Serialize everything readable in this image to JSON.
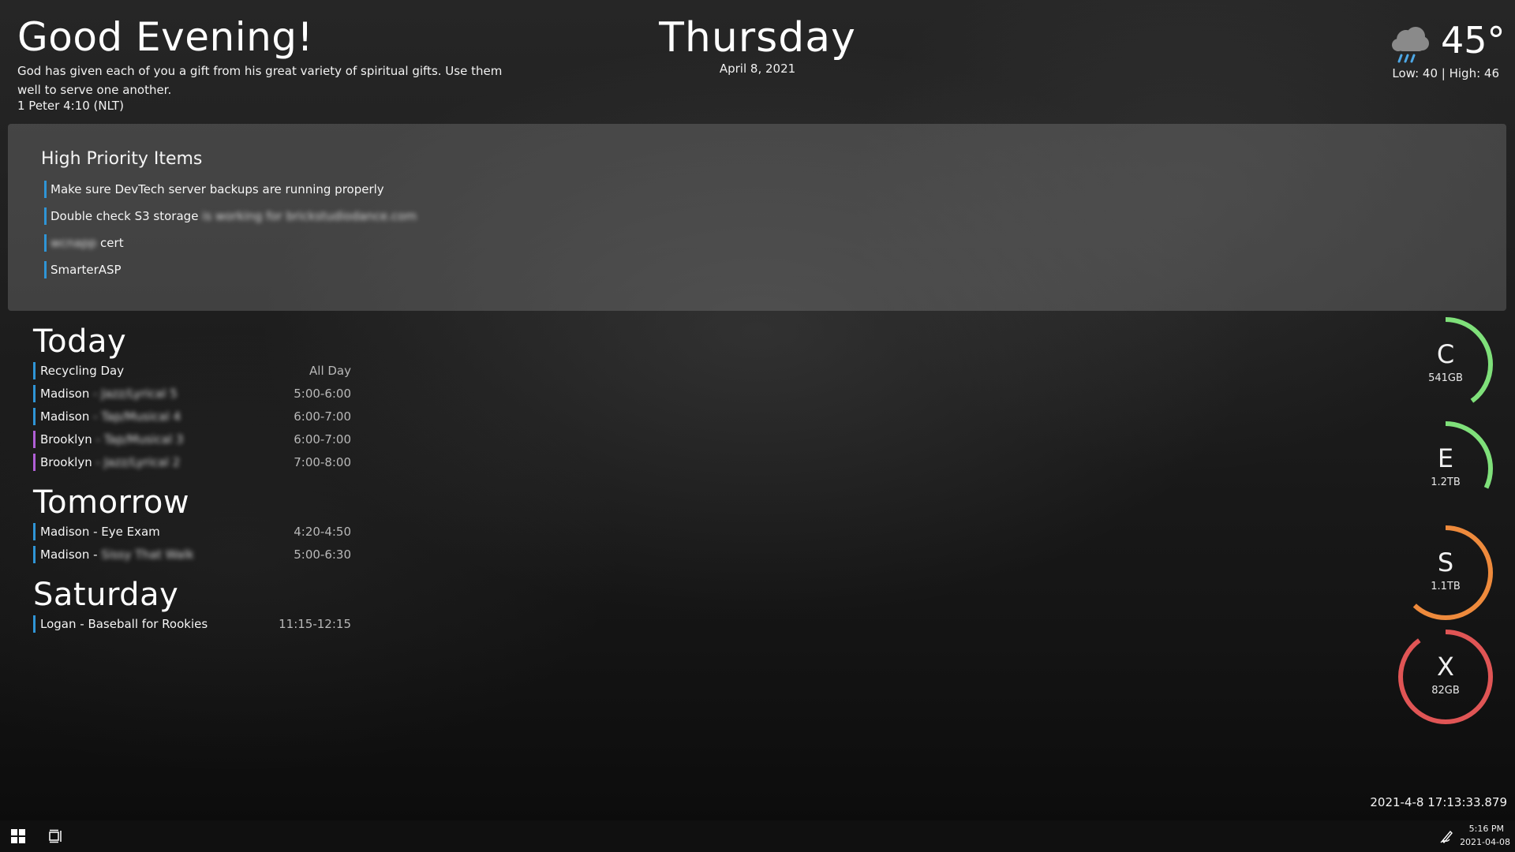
{
  "header": {
    "greeting": "Good Evening!",
    "verse": "God has given each of you a gift from his great variety of spiritual gifts. Use them well to serve one another.",
    "verse_ref": "1 Peter 4:10 (NLT)",
    "day_name": "Thursday",
    "date": "April 8, 2021"
  },
  "weather": {
    "icon": "rain-cloud-icon",
    "temperature": "45°",
    "low_high": "Low: 40 | High: 46"
  },
  "priority": {
    "title": "High Priority Items",
    "accent": "#2f95d6",
    "items": [
      {
        "text": "Make sure DevTech server backups are running properly",
        "redacted": ""
      },
      {
        "text": "Double check S3 storage",
        "redacted": "is working for brickstudiodance.com"
      },
      {
        "text": "cert",
        "redacted": "wcnapp"
      },
      {
        "text": "SmarterASP",
        "redacted": ""
      }
    ]
  },
  "schedule": {
    "today": {
      "title": "Today",
      "events": [
        {
          "name": "Recycling Day",
          "detail": "",
          "time": "All Day",
          "color": "#2f95d6"
        },
        {
          "name": "Madison",
          "detail": "- Jazz/Lyrical 5",
          "time": "5:00-6:00",
          "color": "#2f95d6"
        },
        {
          "name": "Madison",
          "detail": "- Tap/Musical 4",
          "time": "6:00-7:00",
          "color": "#2f95d6"
        },
        {
          "name": "Brooklyn",
          "detail": "- Tap/Musical 3",
          "time": "6:00-7:00",
          "color": "#b05fd6"
        },
        {
          "name": "Brooklyn",
          "detail": "- Jazz/Lyrical 2",
          "time": "7:00-8:00",
          "color": "#b05fd6"
        }
      ]
    },
    "tomorrow": {
      "title": "Tomorrow",
      "events": [
        {
          "name": "Madison - Eye Exam",
          "detail": "",
          "time": "4:20-4:50",
          "color": "#2f95d6"
        },
        {
          "name": "Madison -",
          "detail": "Sissy That Walk",
          "time": "5:00-6:30",
          "color": "#2f95d6"
        }
      ]
    },
    "saturday": {
      "title": "Saturday",
      "events": [
        {
          "name": "Logan - Baseball for Rookies",
          "detail": "",
          "time": "11:15-12:15",
          "color": "#2f95d6"
        }
      ]
    }
  },
  "drives": [
    {
      "letter": "C",
      "size": "541GB",
      "fraction": 0.4,
      "color": "#7fe07a"
    },
    {
      "letter": "E",
      "size": "1.2TB",
      "fraction": 0.32,
      "color": "#7fe07a"
    },
    {
      "letter": "S",
      "size": "1.1TB",
      "fraction": 0.62,
      "color": "#ee8a3c"
    },
    {
      "letter": "X",
      "size": "82GB",
      "fraction": 0.9,
      "color": "#e05555"
    }
  ],
  "timestamp": "2021-4-8 17:13:33.879",
  "taskbar": {
    "start_icon": "windows-logo-icon",
    "taskview_icon": "task-view-icon",
    "tray_icon": "pen-icon",
    "clock_time": "5:16 PM",
    "clock_date": "2021-04-08"
  }
}
